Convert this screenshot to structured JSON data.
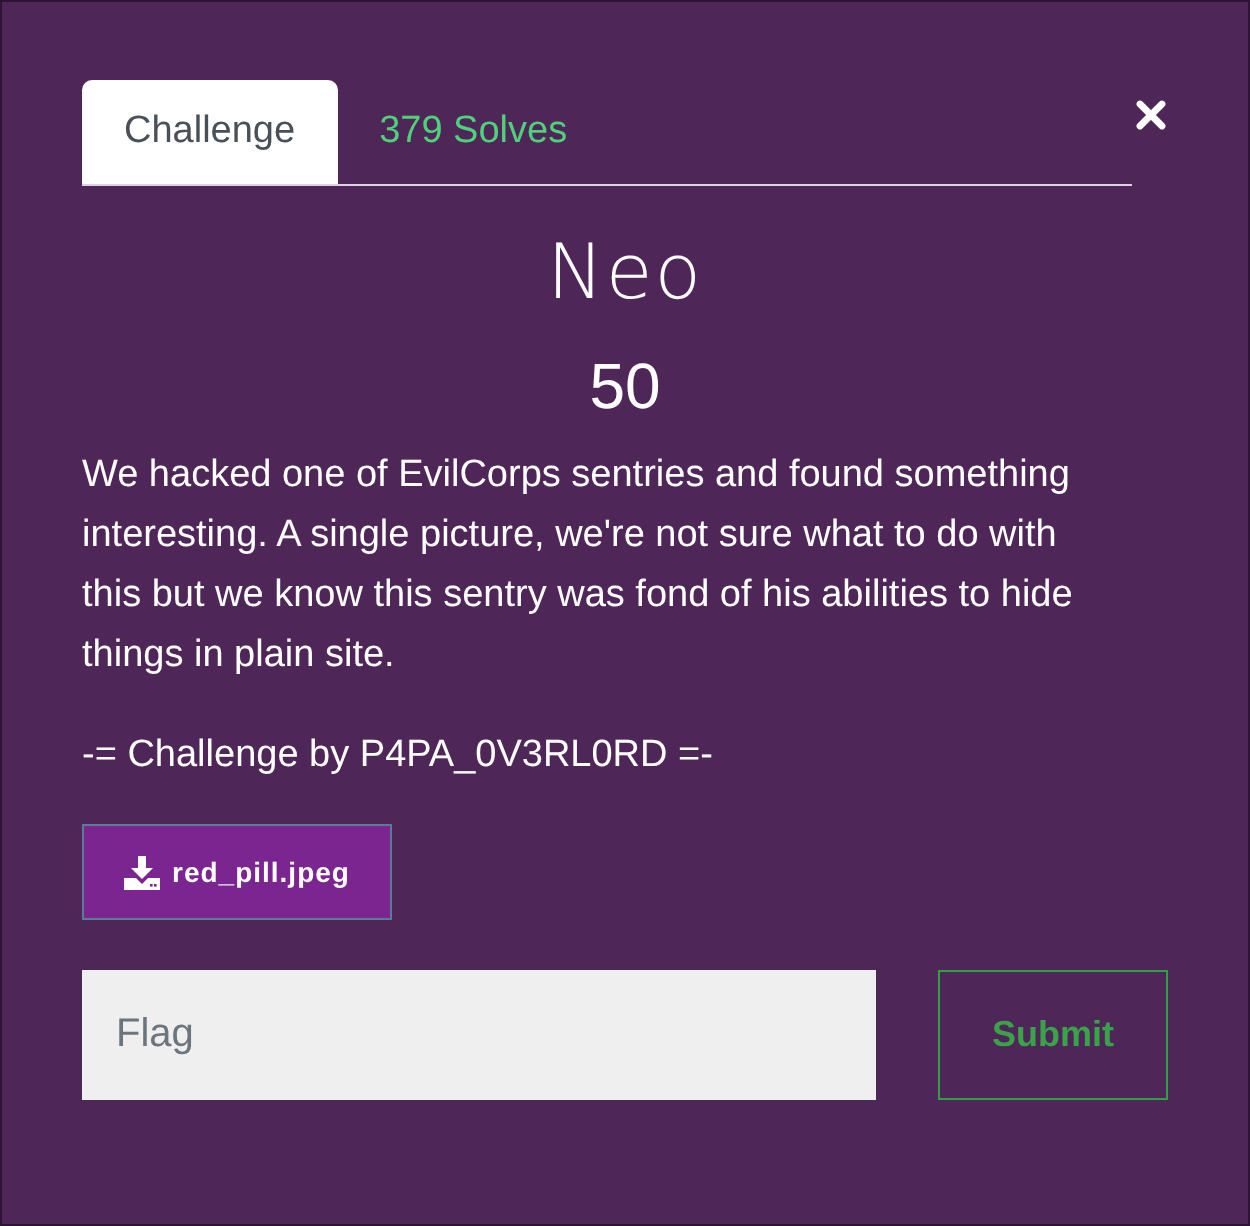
{
  "tabs": [
    {
      "label": "Challenge",
      "selected": true
    },
    {
      "label": "379 Solves",
      "selected": false
    }
  ],
  "challenge": {
    "name": "Neo",
    "value": "50",
    "description": "We hacked one of EvilCorps sentries and found something interesting. A single picture, we're not sure what to do with this but we know this sentry was fond of his abilities to hide things in plain site.",
    "author": "-= Challenge by P4PA_0V3RL0RD =-"
  },
  "files": [
    {
      "name": "red_pill.jpeg"
    }
  ],
  "flag_input": {
    "placeholder": "Flag"
  },
  "submit": {
    "label": "Submit"
  }
}
